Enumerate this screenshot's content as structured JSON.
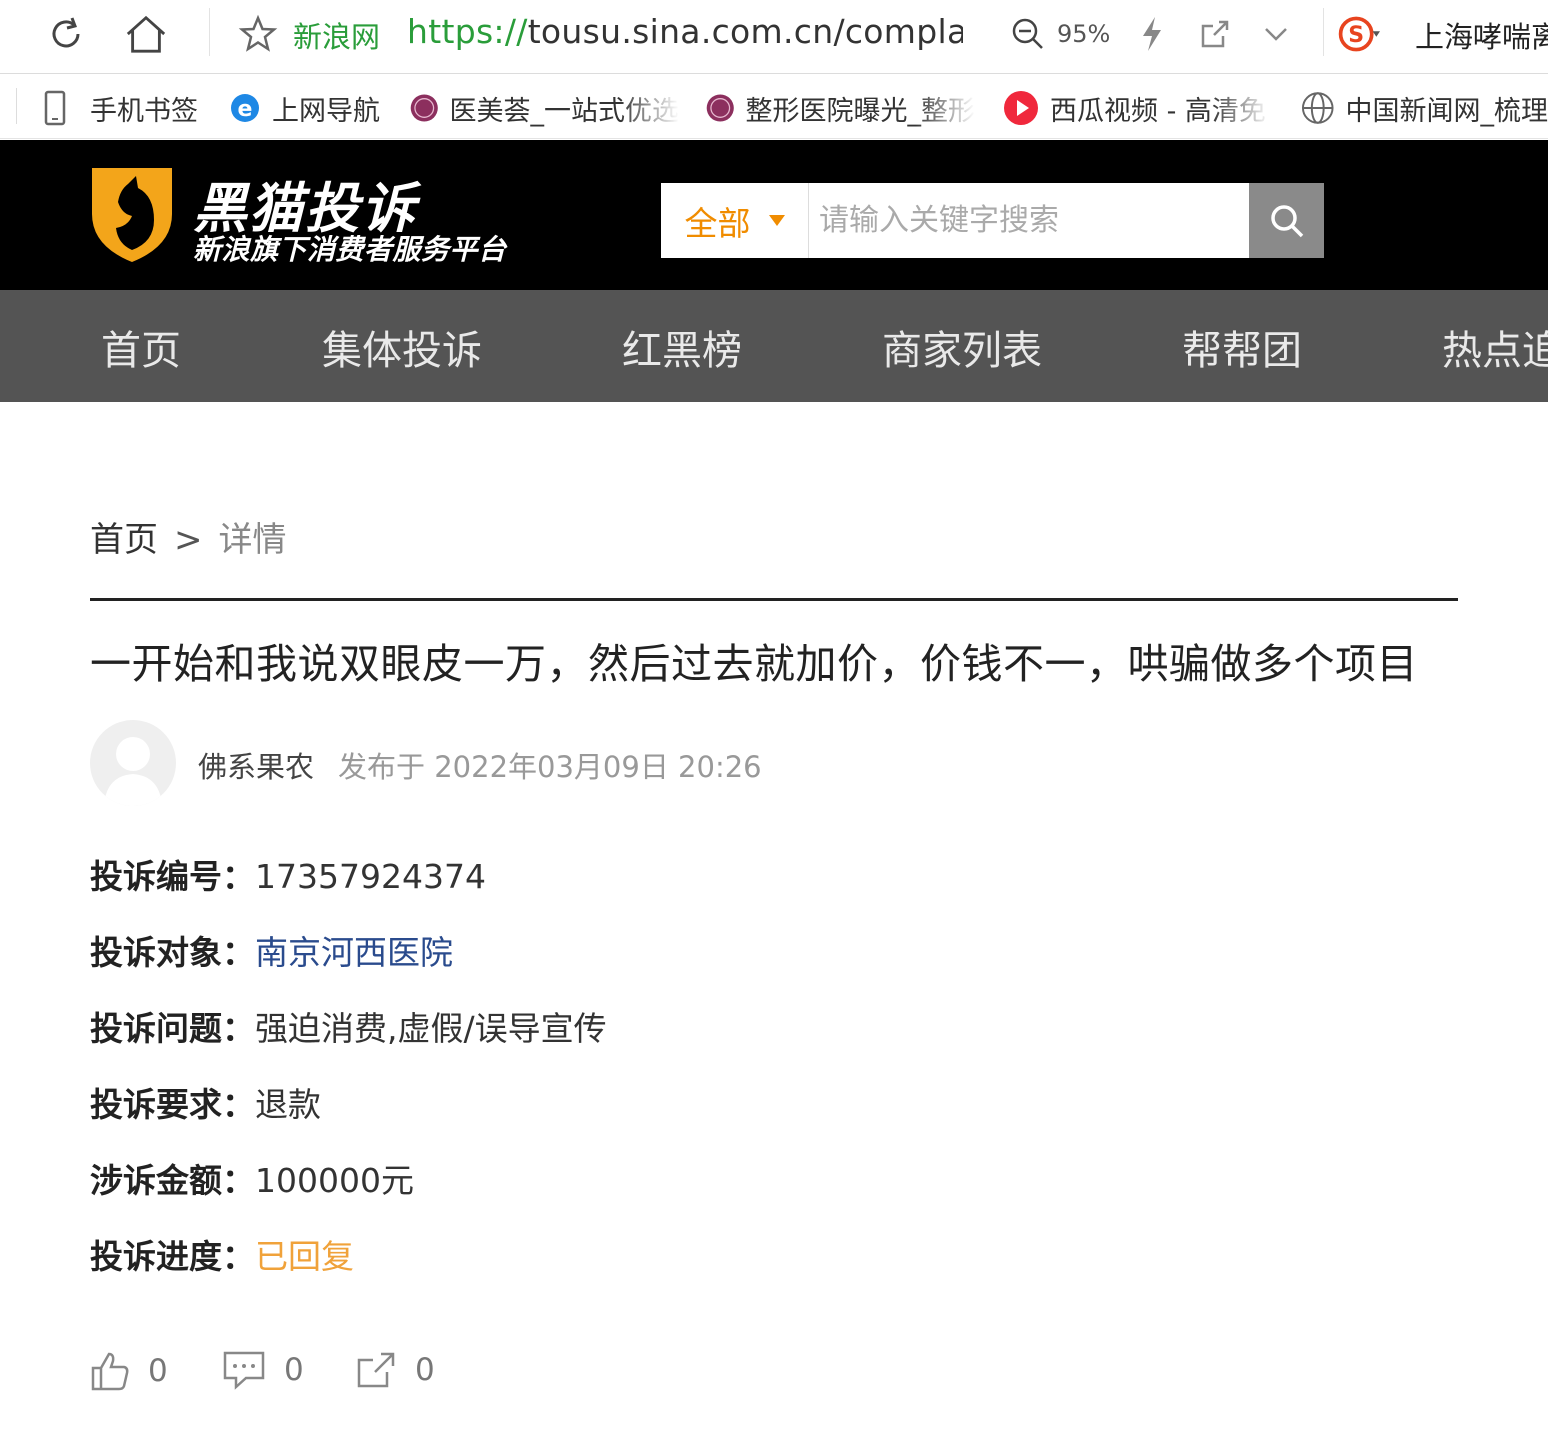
{
  "browser": {
    "site_name": "新浪网",
    "url_protocol": "https://",
    "url_rest": "tousu.sina.com.cn/complaint/",
    "zoom": "95%",
    "extension_text": "上海哮喘离"
  },
  "bookmarks": [
    {
      "label": "手机书签",
      "icon": "phone-icon"
    },
    {
      "label": "上网导航",
      "icon": "ie-icon"
    },
    {
      "label": "医美荟_一站式优选",
      "icon": "yimeihui-icon"
    },
    {
      "label": "整形医院曝光_整形",
      "icon": "yimeihui-icon"
    },
    {
      "label": "西瓜视频 - 高清免",
      "icon": "xigua-icon"
    },
    {
      "label": "中国新闻网_梳理",
      "icon": "globe-icon"
    }
  ],
  "header": {
    "logo_title": "黑猫投诉",
    "logo_subtitle": "新浪旗下消费者服务平台",
    "search_category": "全部",
    "search_placeholder": "请输入关键字搜索"
  },
  "nav": [
    "首页",
    "集体投诉",
    "红黑榜",
    "商家列表",
    "帮帮团",
    "热点追"
  ],
  "breadcrumb": {
    "home": "首页",
    "separator": ">",
    "current": "详情"
  },
  "complaint": {
    "title": "一开始和我说双眼皮一万，然后过去就加价，价钱不一，哄骗做多个项目",
    "author": "佛系果农",
    "published": "发布于 2022年03月09日 20:26",
    "fields": [
      {
        "key": "投诉编号：",
        "value": "17357924374",
        "style": "plain"
      },
      {
        "key": "投诉对象：",
        "value": "南京河西医院",
        "style": "link"
      },
      {
        "key": "投诉问题：",
        "value": "强迫消费,虚假/误导宣传",
        "style": "plain"
      },
      {
        "key": "投诉要求：",
        "value": "退款",
        "style": "plain"
      },
      {
        "key": "涉诉金额：",
        "value": "100000元",
        "style": "plain"
      },
      {
        "key": "投诉进度：",
        "value": "已回复",
        "style": "orange"
      }
    ],
    "actions": {
      "likes": "0",
      "comments": "0",
      "shares": "0"
    }
  },
  "colors": {
    "accent_orange": "#f08c00",
    "header_bg": "#000000",
    "nav_bg": "#545454",
    "link_blue": "#2a4b8d",
    "status_orange": "#f0a23a",
    "browser_green": "#2a9d3a"
  }
}
